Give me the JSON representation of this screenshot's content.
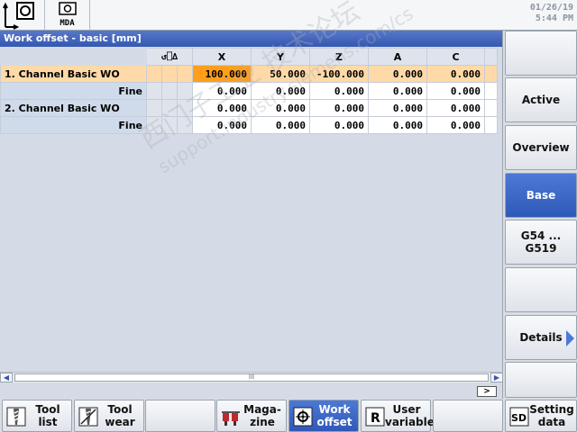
{
  "header": {
    "machine_icon": "machine-area-icon",
    "mda_icon": "mda-mode-icon",
    "mda_label": "MDA",
    "date": "01/26/19",
    "time": "5:44 PM"
  },
  "panel": {
    "title": "Work offset - basic [mm]",
    "header_icons": "↺⎕∆",
    "columns": [
      "X",
      "Y",
      "Z",
      "A",
      "C"
    ],
    "rows": [
      {
        "label": "1. Channel Basic WO",
        "values": [
          "100.000",
          "50.000",
          "-100.000",
          "0.000",
          "0.000"
        ]
      },
      {
        "label": "Fine",
        "values": [
          "0.000",
          "0.000",
          "0.000",
          "0.000",
          "0.000"
        ]
      },
      {
        "label": "2. Channel Basic WO",
        "values": [
          "0.000",
          "0.000",
          "0.000",
          "0.000",
          "0.000"
        ]
      },
      {
        "label": "Fine",
        "values": [
          "0.000",
          "0.000",
          "0.000",
          "0.000",
          "0.000"
        ]
      }
    ],
    "scroll_thumb": "III",
    "more_label": ">",
    "watermark_cn": "西门子工业 技术论坛",
    "watermark_url": "support.industry.siemens.com/cs"
  },
  "softkeys_vertical": [
    "",
    "Active",
    "Overview",
    "Base",
    "G54 ...\nG519",
    "",
    "Details",
    ""
  ],
  "softkeys_vertical_selected": 3,
  "softkeys_horizontal": [
    {
      "label": "Tool\nlist",
      "icon": "tool-list-icon"
    },
    {
      "label": "Tool\nwear",
      "icon": "tool-wear-icon"
    },
    {
      "label": "",
      "icon": ""
    },
    {
      "label": "Maga-\nzine",
      "icon": "magazine-icon"
    },
    {
      "label": "Work\noffset",
      "icon": "work-offset-icon"
    },
    {
      "label": "User\nvariable",
      "icon": "user-variable-icon"
    },
    {
      "label": "",
      "icon": ""
    },
    {
      "label": "Setting\ndata",
      "icon": "setting-data-icon"
    }
  ],
  "colors": {
    "title_blue": "#3457b1",
    "active_row": "#ffd9a8",
    "focus_cell": "#ff9e1b",
    "selected_key": "#2f59b8"
  }
}
